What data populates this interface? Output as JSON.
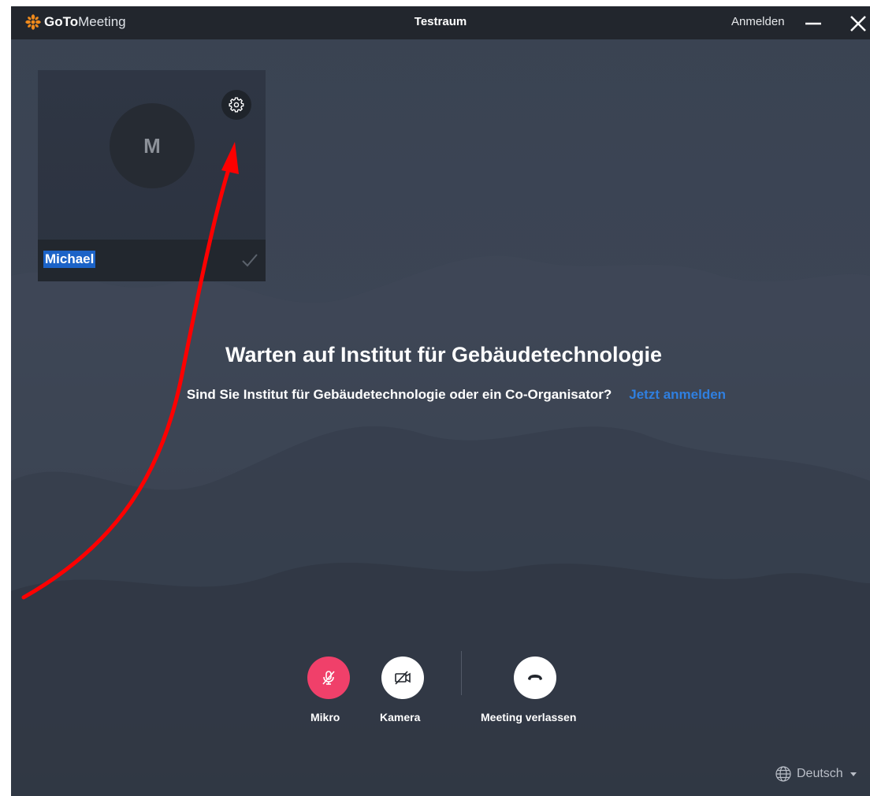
{
  "titlebar": {
    "logo_bold": "GoTo",
    "logo_thin": "Meeting",
    "title": "Testraum",
    "signin_label": "Anmelden",
    "minimize_icon": "minimize-icon",
    "close_icon": "close-icon"
  },
  "video_tile": {
    "avatar_initial": "M",
    "settings_icon": "gear-icon",
    "name_value": "Michael",
    "confirm_icon": "check-icon"
  },
  "waiting": {
    "title": "Warten auf Institut für Gebäudetechnologie",
    "question": "Sind Sie Institut für Gebäudetechnologie oder ein Co-Organisator?",
    "signin_link": "Jetzt anmelden"
  },
  "controls": {
    "mic_label": "Mikro",
    "mic_icon": "mic-muted-icon",
    "camera_label": "Kamera",
    "camera_icon": "camera-off-icon",
    "leave_label": "Meeting verlassen",
    "leave_icon": "hangup-icon"
  },
  "language": {
    "selected": "Deutsch",
    "icon": "globe-icon"
  },
  "colors": {
    "mic_muted": "#f0406a",
    "link": "#2f7fe0",
    "logo_accent": "#f08a1c",
    "annotation_arrow": "#ff0000"
  }
}
